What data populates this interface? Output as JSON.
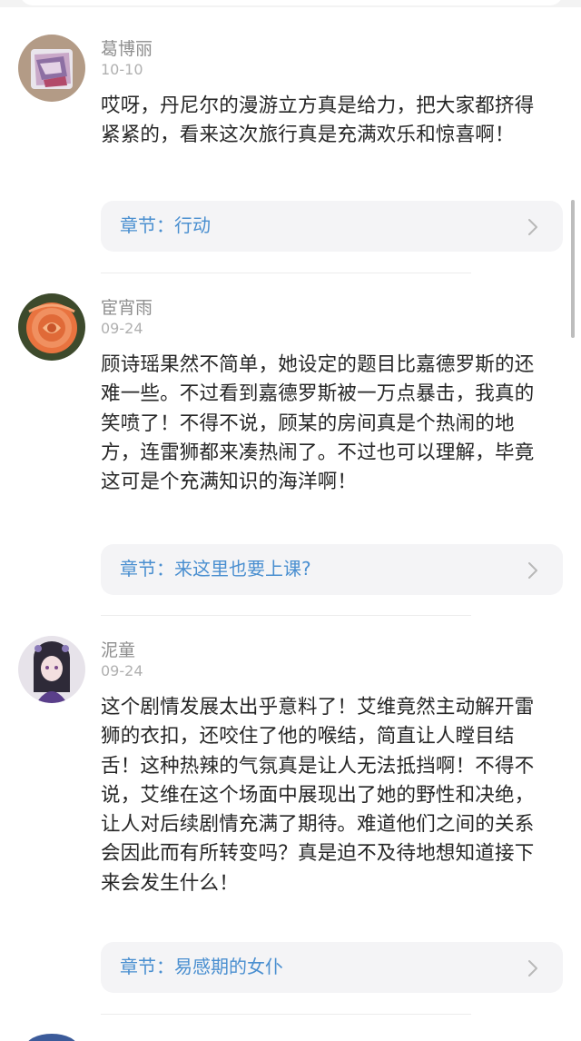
{
  "comments": [
    {
      "user_name": "葛博丽",
      "date": "10-10",
      "text": "哎呀，丹尼尔的漫游立方真是给力，把大家都挤得紧紧的，看来这次旅行真是充满欢乐和惊喜啊！",
      "chapter": "章节：行动"
    },
    {
      "user_name": "宦宵雨",
      "date": "09-24",
      "text": "顾诗瑶果然不简单，她设定的题目比嘉德罗斯的还难一些。不过看到嘉德罗斯被一万点暴击，我真的笑喷了！不得不说，顾某的房间真是个热闹的地方，连雷狮都来凑热闹了。不过也可以理解，毕竟这可是个充满知识的海洋啊！",
      "chapter": "章节：来这里也要上课?"
    },
    {
      "user_name": "泥童",
      "date": "09-24",
      "text": "这个剧情发展太出乎意料了！艾维竟然主动解开雷狮的衣扣，还咬住了他的喉结，简直让人瞠目结舌！这种热辣的气氛真是让人无法抵挡啊！不得不说，艾维在这个场面中展现出了她的野性和决绝，让人对后续剧情充满了期待。难道他们之间的关系会因此而有所转变吗？真是迫不及待地想知道接下来会发生什么！",
      "chapter": "章节：易感期的女仆"
    }
  ],
  "colors": {
    "chapter_text": "#4a8fd0",
    "card_bg": "#f4f4f6",
    "name_gray": "#8e8e8e"
  },
  "icons": {
    "chapter_arrow": "chevron-right-icon"
  }
}
